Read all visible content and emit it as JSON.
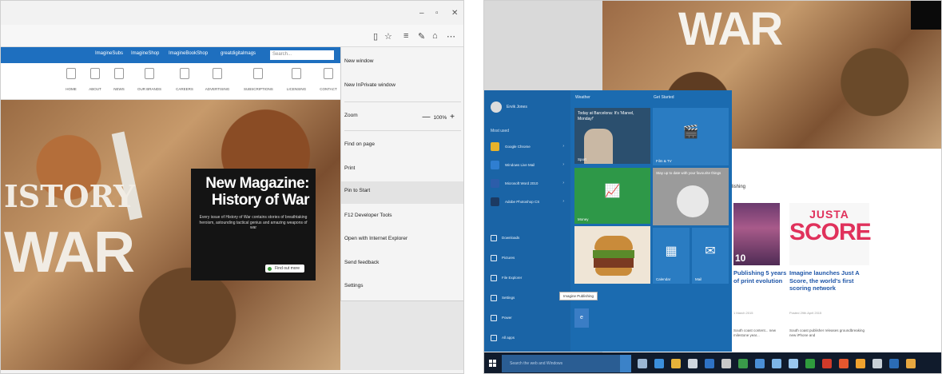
{
  "left_browser": {
    "window_controls": [
      "–",
      "▫",
      "✕"
    ],
    "site_nav_top": [
      "ImagineSubs",
      "ImagineShop",
      "ImagineBookShop",
      "greatdigitalmags"
    ],
    "site_search_placeholder": "Search...",
    "nav_items": [
      "HOME",
      "ABOUT",
      "NEWS",
      "OUR BRANDS",
      "CAREERS",
      "ADVERTISING",
      "SUBSCRIPTIONS",
      "LICENSING",
      "CONTACT"
    ],
    "hero_text_top": "ISTORY",
    "hero_text_bottom": "WAR",
    "promo": {
      "title": "New Magazine: History of War",
      "body": "Every issue of History of War contains stories of breathtaking heroism, astounding tactical genius and amazing weapons of war",
      "button": "Find out more"
    },
    "menu": {
      "items": [
        "New window",
        "New InPrivate window",
        "Zoom",
        "Find on page",
        "Print",
        "Pin to Start",
        "F12 Developer Tools",
        "Open with Internet Explorer",
        "Send feedback",
        "Settings"
      ],
      "zoom_value": "100%",
      "zoom_minus": "—",
      "zoom_plus": "+"
    }
  },
  "right_start": {
    "desktop_title": "WAR",
    "publishing_fragment": "lishing",
    "user_name": "Ervik Jones",
    "most_used_label": "Most used",
    "apps": [
      {
        "label": "Google Chrome",
        "color": "#e8b32a"
      },
      {
        "label": "Windows Live Mail",
        "color": "#2f7ed1"
      },
      {
        "label": "Microsoft Word 2010",
        "color": "#2c5daa"
      },
      {
        "label": "Adobe Photoshop CS",
        "color": "#1c3a63"
      }
    ],
    "system_links": [
      "Downloads",
      "Pictures",
      "File Explorer",
      "Settings",
      "Power",
      "All apps"
    ],
    "group_labels": [
      "Weather",
      "Get Started"
    ],
    "news_tile_text": "Today at Barcelona: It's 'Marvel, Monday!'",
    "tiles": {
      "sport": "Sport",
      "film_tv": "Film & TV",
      "money": "Money",
      "photos_text": "Stay up to date with your favourite things",
      "calendar": "Calendar",
      "mail": "Mail"
    },
    "tooltip": "Imagine Publishing",
    "stories": [
      {
        "title": "Publishing 5 years of print evolution",
        "date": "1 March 2015"
      },
      {
        "title": "Imagine launches Just A Score, the world's first scoring network",
        "date": "Posted 29th April 2015"
      }
    ],
    "story_bodies": [
      "South coast content... new milestone year...",
      "South coast publisher releases groundbreaking new iPhone and"
    ],
    "score_logo_top": "JUSTA",
    "score_logo_main": "SCORE",
    "taskbar_search": "Search the web and Windows",
    "taskbar_app_colors": [
      "#9bb7d4",
      "#3b8fdc",
      "#e6b33a",
      "#cfd6de",
      "#2e72c4",
      "#c9c9c9",
      "#3a9a4a",
      "#4a8fd6",
      "#7db6e8",
      "#9ac7ee",
      "#2f9c3d",
      "#d23a2a",
      "#e4572e",
      "#f0a22e",
      "#c8d0d8",
      "#2b6cb6",
      "#e8a840"
    ]
  }
}
